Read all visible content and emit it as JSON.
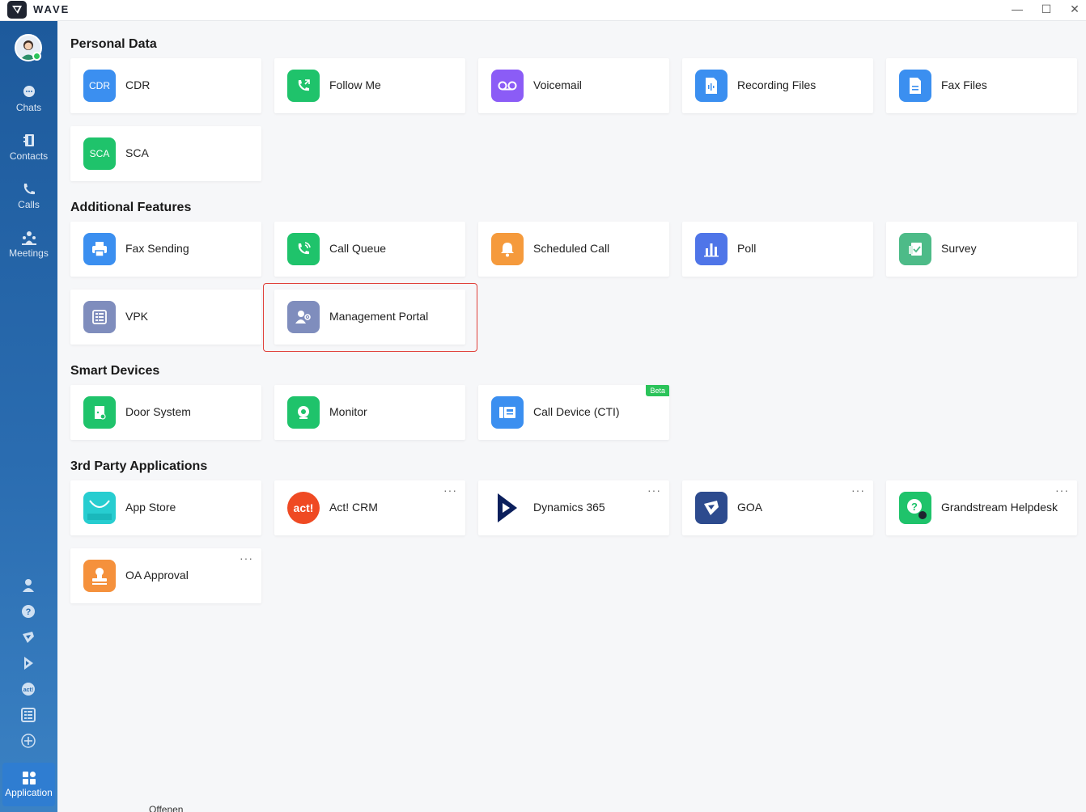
{
  "window": {
    "app_name": "WAVE",
    "min_glyph": "—",
    "max_glyph": "☐",
    "close_glyph": "✕"
  },
  "sidebar": {
    "nav": [
      {
        "label": "Chats",
        "icon": "chat-icon"
      },
      {
        "label": "Contacts",
        "icon": "contacts-icon"
      },
      {
        "label": "Calls",
        "icon": "phone-icon"
      },
      {
        "label": "Meetings",
        "icon": "meetings-icon"
      }
    ],
    "bottom_icons": [
      "user-icon",
      "help-icon",
      "goa-icon",
      "dynamics-icon",
      "act-icon",
      "vpk-icon",
      "add-icon"
    ],
    "active": {
      "label": "Application",
      "icon": "application-grid-icon"
    }
  },
  "sections": {
    "personal": {
      "title": "Personal Data",
      "cards": [
        {
          "label": "CDR",
          "icon_text": "CDR",
          "color": "#3b8ff0"
        },
        {
          "label": "Follow Me",
          "icon": "follow-me-phone-icon",
          "color": "#1fc36b"
        },
        {
          "label": "Voicemail",
          "icon": "voicemail-icon",
          "color": "#8b5cf6"
        },
        {
          "label": "Recording Files",
          "icon": "recording-file-icon",
          "color": "#3b8ff0"
        },
        {
          "label": "Fax Files",
          "icon": "fax-file-icon",
          "color": "#3b8ff0"
        },
        {
          "label": "SCA",
          "icon_text": "SCA",
          "color": "#1fc36b"
        }
      ]
    },
    "additional": {
      "title": "Additional Features",
      "cards": [
        {
          "label": "Fax Sending",
          "icon": "printer-icon",
          "color": "#3b8ff0"
        },
        {
          "label": "Call Queue",
          "icon": "call-queue-icon",
          "color": "#1fc36b"
        },
        {
          "label": "Scheduled Call",
          "icon": "bell-icon",
          "color": "#f59a3c"
        },
        {
          "label": "Poll",
          "icon": "poll-chart-icon",
          "color": "#4f75e8"
        },
        {
          "label": "Survey",
          "icon": "survey-icon",
          "color": "#4dbb88"
        },
        {
          "label": "VPK",
          "icon": "vpk-icon",
          "color": "#7f8dbd"
        },
        {
          "label": "Management Portal",
          "icon": "management-portal-icon",
          "color": "#7f8dbd"
        }
      ]
    },
    "smart": {
      "title": "Smart Devices",
      "cards": [
        {
          "label": "Door System",
          "icon": "door-system-icon",
          "color": "#1fc36b"
        },
        {
          "label": "Monitor",
          "icon": "monitor-camera-icon",
          "color": "#1fc36b"
        },
        {
          "label": "Call Device (CTI)",
          "icon": "call-device-icon",
          "color": "#3b8ff0",
          "badge": "Beta"
        }
      ]
    },
    "third_party": {
      "title": "3rd Party Applications",
      "cards": [
        {
          "label": "App Store",
          "icon": "app-store-icon",
          "color": "#27cdd0"
        },
        {
          "label": "Act! CRM",
          "icon_text": "act!",
          "color": "#ef4a23",
          "more": "···"
        },
        {
          "label": "Dynamics 365",
          "icon": "dynamics-365-icon",
          "color": "#ffffff",
          "more": "···"
        },
        {
          "label": "GOA",
          "icon": "goa-icon",
          "color": "#2d4b8e",
          "more": "···"
        },
        {
          "label": "Grandstream Helpdesk",
          "icon": "helpdesk-icon",
          "color": "#1fc36b",
          "more": "···"
        },
        {
          "label": "OA Approval",
          "icon": "oa-approval-icon",
          "color": "#f5913c",
          "more": "···"
        }
      ]
    }
  },
  "footer": {
    "clipped_text": "Offenen"
  }
}
